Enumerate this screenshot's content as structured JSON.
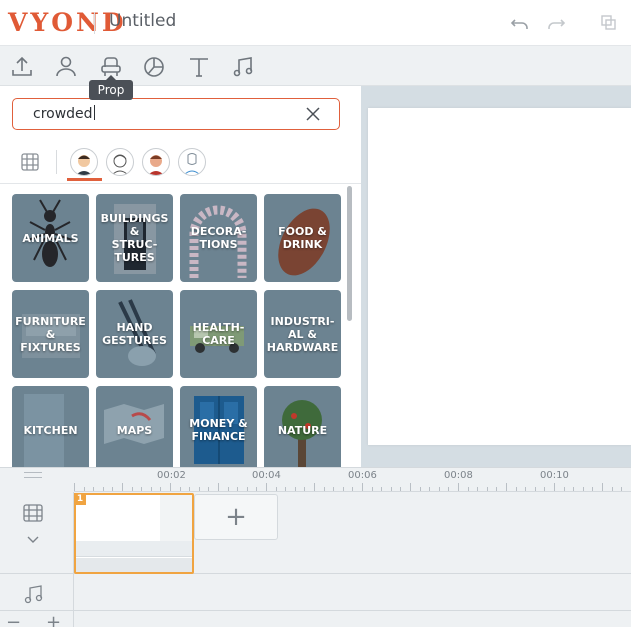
{
  "header": {
    "logo": "VYOND",
    "title": "Untitled",
    "icons": [
      "undo-icon",
      "redo-icon",
      "duplicate-icon"
    ]
  },
  "toolbar": {
    "items": [
      "upload-icon",
      "character-icon",
      "prop-icon",
      "chart-icon",
      "text-icon",
      "audio-icon"
    ],
    "tooltip": "Prop"
  },
  "library": {
    "search_value": "crowded",
    "style_options": [
      "contemporary",
      "whiteboard",
      "business-friendly",
      "infographic"
    ],
    "categories": [
      {
        "label": "ANIMALS"
      },
      {
        "label": "BUILDINGS\n&\nSTRUC-\nTURES"
      },
      {
        "label": "DECORA-\nTIONS"
      },
      {
        "label": "FOOD &\nDRINK"
      },
      {
        "label": "FURNITURE\n& FIXTURES"
      },
      {
        "label": "HAND\nGESTURES"
      },
      {
        "label": "HEALTH-\nCARE"
      },
      {
        "label": "INDUSTRI-\nAL &\nHARDWARE"
      },
      {
        "label": "KITCHEN"
      },
      {
        "label": "MAPS"
      },
      {
        "label": "MONEY &\nFINANCE"
      },
      {
        "label": "NATURE"
      }
    ]
  },
  "timeline": {
    "ruler": [
      "00:02",
      "00:04",
      "00:06",
      "00:08",
      "00:10"
    ],
    "scene_number": "1",
    "add_scene_label": "+",
    "zoom_out": "−",
    "zoom_in": "+"
  },
  "colors": {
    "accent": "#e05a36",
    "tile": "#6c8391",
    "scene_selected": "#f0a441"
  }
}
